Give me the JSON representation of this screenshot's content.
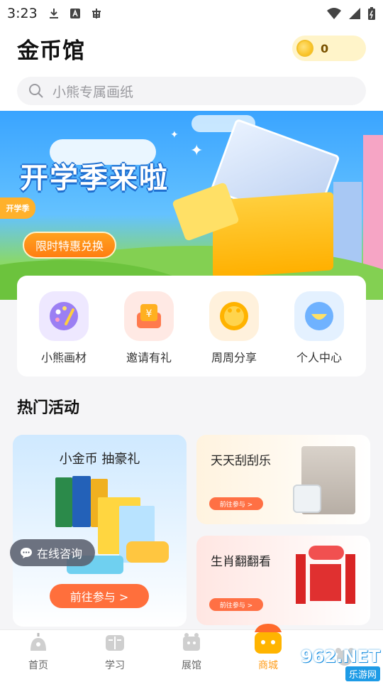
{
  "status_bar": {
    "time": "3:23"
  },
  "header": {
    "title": "金币馆",
    "coin_count": "0"
  },
  "search": {
    "placeholder": "小熊专属画纸"
  },
  "banner": {
    "title": "开学季来啦",
    "sign_text": "开学季",
    "button_label": "限时特惠兑换"
  },
  "quick_menu": {
    "items": [
      {
        "label": "小熊画材",
        "icon": "palette-icon",
        "bg": "#eee8ff"
      },
      {
        "label": "邀请有礼",
        "icon": "gift-coupon-icon",
        "bg": "#ffe9e4"
      },
      {
        "label": "周周分享",
        "icon": "bear-coin-icon",
        "bg": "#fff1dc"
      },
      {
        "label": "个人中心",
        "icon": "user-icon",
        "bg": "#e4f1ff"
      }
    ]
  },
  "section": {
    "hot_title": "热门活动"
  },
  "activities": {
    "big": {
      "title": "小金币 抽豪礼",
      "button": "前往参与 >"
    },
    "scratch": {
      "title": "天天刮刮乐",
      "button": "前往参与 >"
    },
    "zodiac": {
      "title": "生肖翻翻看",
      "button": "前往参与 >"
    }
  },
  "consult": {
    "label": "在线咨询"
  },
  "tabs": [
    {
      "label": "首页",
      "icon": "home-bear-icon",
      "active": false
    },
    {
      "label": "学习",
      "icon": "book-icon",
      "active": false
    },
    {
      "label": "展馆",
      "icon": "gallery-icon",
      "active": false
    },
    {
      "label": "商城",
      "icon": "shop-icon",
      "active": true
    },
    {
      "label": "",
      "icon": "profile-bear-icon",
      "active": false
    }
  ],
  "watermark": {
    "top": "962.NET",
    "bottom": "乐游网"
  },
  "colors": {
    "accent": "#ff9d1a",
    "cta": "#ff6f3c",
    "banner_sky": "#3aa4ff"
  }
}
